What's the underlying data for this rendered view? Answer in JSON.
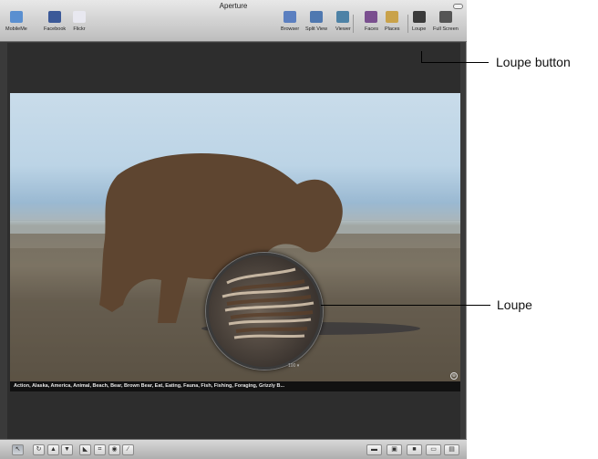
{
  "window": {
    "title": "Aperture"
  },
  "toolbar": {
    "left_buttons": [
      {
        "label": "MobileMe",
        "icon": "mobileme-icon",
        "color": "#5a8fd0"
      },
      {
        "label": "Facebook",
        "icon": "facebook-icon",
        "color": "#3b5998"
      },
      {
        "label": "Flickr",
        "icon": "flickr-icon",
        "color": "#e8e8f0"
      }
    ],
    "right_buttons": [
      {
        "label": "Browser",
        "icon": "browser-icon",
        "color": "#5b7fc0"
      },
      {
        "label": "Split View",
        "icon": "split-view-icon",
        "color": "#4f78b0"
      },
      {
        "label": "Viewer",
        "icon": "viewer-icon",
        "color": "#4d82a6"
      },
      {
        "label": "Faces",
        "icon": "faces-icon",
        "color": "#7a4f8f"
      },
      {
        "label": "Places",
        "icon": "places-icon",
        "color": "#c9a24a"
      },
      {
        "label": "Loupe",
        "icon": "loupe-icon",
        "color": "#3a3a3a"
      },
      {
        "label": "Full Screen",
        "icon": "full-screen-icon",
        "color": "#555555"
      }
    ]
  },
  "photo": {
    "keywords": "Action, Alaska, America, Animal, Beach, Bear, Brown Bear, Eat, Eating, Fauna, Fish, Fishing, Foraging, Grizzly B..."
  },
  "loupe": {
    "zoom": "100 ▾"
  },
  "bottom_toolbar": {
    "left_tools": [
      {
        "icon": "select-tool-icon",
        "glyph": "↖"
      },
      {
        "icon": "rotate-tool-icon",
        "glyph": "↻"
      },
      {
        "icon": "lift-tool-icon",
        "glyph": "▲"
      },
      {
        "icon": "stamp-tool-icon",
        "glyph": "▼"
      },
      {
        "icon": "straighten-tool-icon",
        "glyph": "◣"
      },
      {
        "icon": "crop-tool-icon",
        "glyph": "⌗"
      },
      {
        "icon": "red-eye-tool-icon",
        "glyph": "◉"
      },
      {
        "icon": "brush-tool-icon",
        "glyph": "∕"
      }
    ],
    "right_tools": [
      {
        "icon": "photo-mode-icon",
        "glyph": "▬"
      },
      {
        "icon": "viewer-mode-icon",
        "glyph": "▣"
      },
      {
        "icon": "inspector-icon",
        "glyph": "■"
      },
      {
        "icon": "two-up-icon",
        "glyph": "▭"
      },
      {
        "icon": "filmstrip-icon",
        "glyph": "▤"
      }
    ]
  },
  "callouts": {
    "loupe_button": "Loupe button",
    "loupe": "Loupe"
  }
}
